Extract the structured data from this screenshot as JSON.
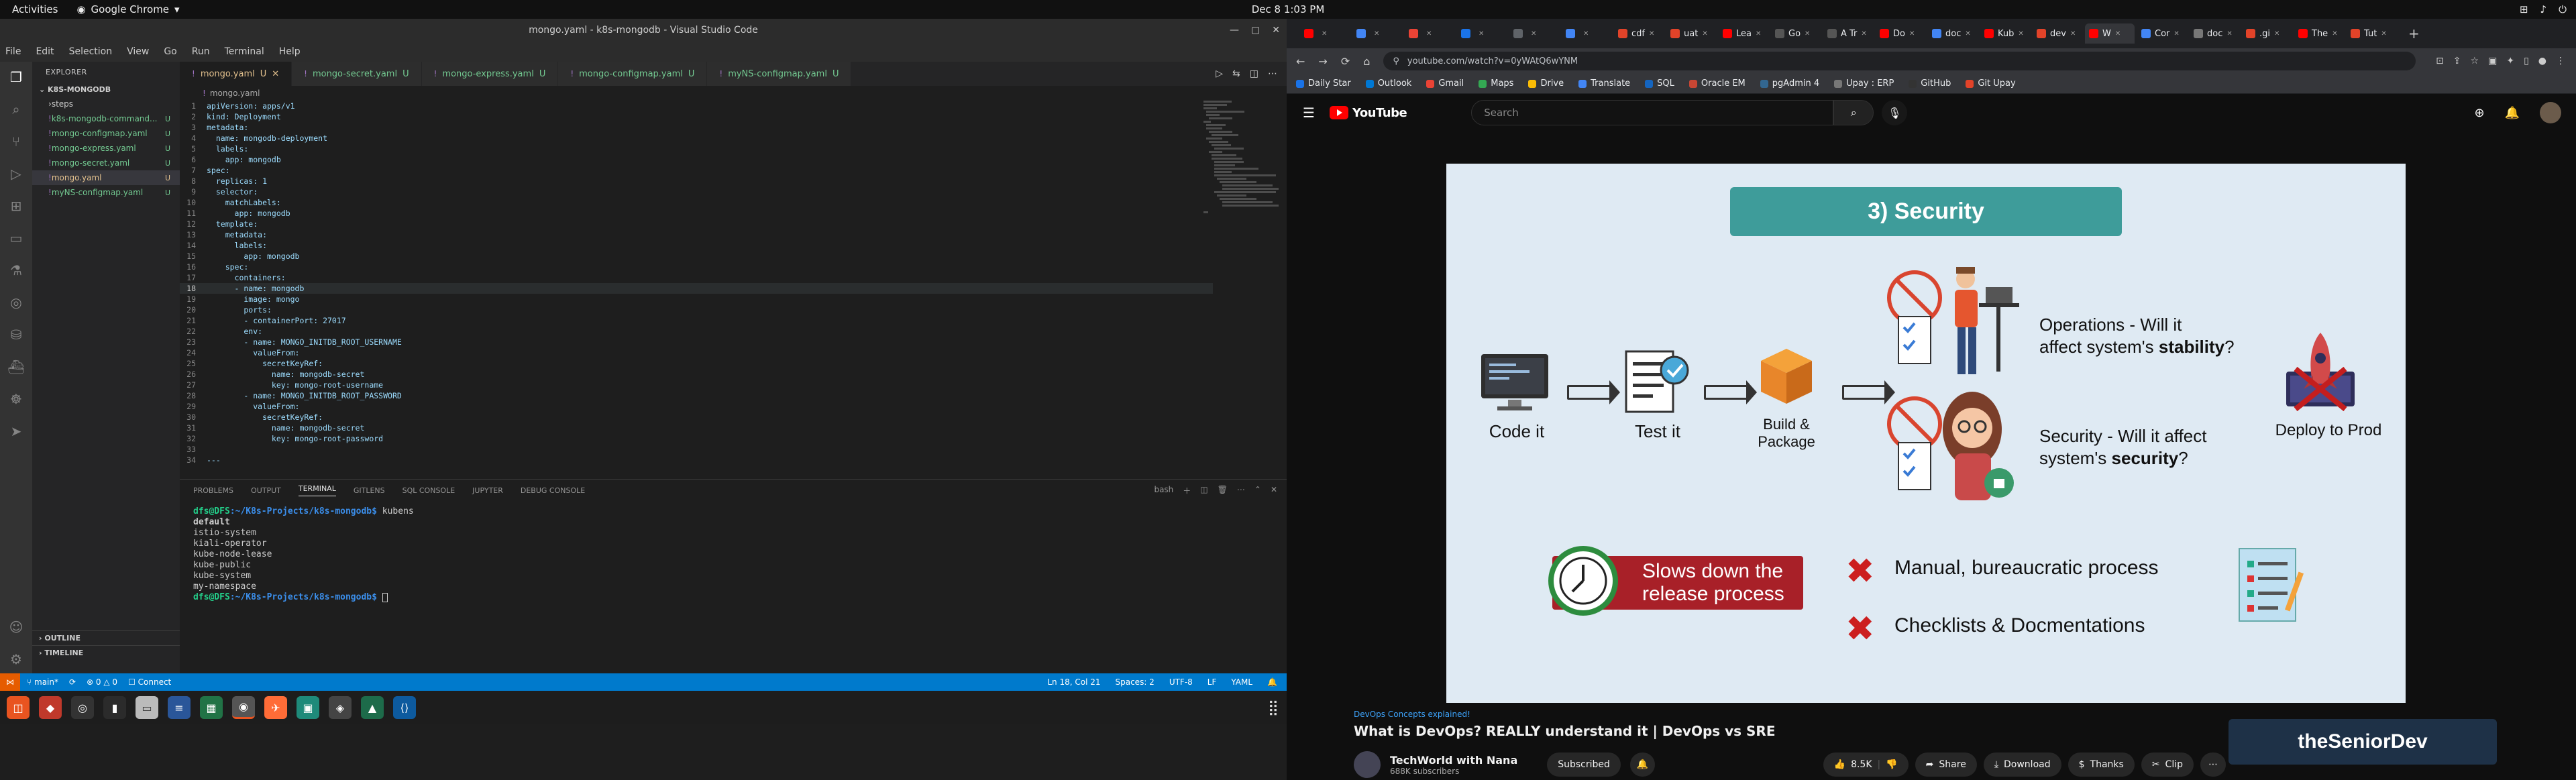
{
  "topbar": {
    "activities": "Activities",
    "app": "Google Chrome",
    "clock": "Dec 8  1:03 PM"
  },
  "vscode": {
    "window_title": "mongo.yaml - k8s-mongodb - Visual Studio Code",
    "menu": [
      "File",
      "Edit",
      "Selection",
      "View",
      "Go",
      "Run",
      "Terminal",
      "Help"
    ],
    "explorer_label": "EXPLORER",
    "folder": "K8S-MONGODB",
    "files": [
      {
        "name": "steps",
        "badge": "",
        "folder": true
      },
      {
        "name": "k8s-mongodb-command...",
        "badge": "U"
      },
      {
        "name": "mongo-configmap.yaml",
        "badge": "U"
      },
      {
        "name": "mongo-express.yaml",
        "badge": "U"
      },
      {
        "name": "mongo-secret.yaml",
        "badge": "U"
      },
      {
        "name": "mongo.yaml",
        "badge": "U",
        "active": true
      },
      {
        "name": "myNS-configmap.yaml",
        "badge": "U"
      }
    ],
    "outline": "OUTLINE",
    "timeline": "TIMELINE",
    "tabs": [
      {
        "name": "mongo.yaml",
        "badge": "U",
        "active": true
      },
      {
        "name": "mongo-secret.yaml",
        "badge": "U"
      },
      {
        "name": "mongo-express.yaml",
        "badge": "U"
      },
      {
        "name": "mongo-configmap.yaml",
        "badge": "U"
      },
      {
        "name": "myNS-configmap.yaml",
        "badge": "U"
      }
    ],
    "breadcrumb": "mongo.yaml",
    "code": [
      "apiVersion: apps/v1",
      "kind: Deployment",
      "metadata:",
      "  name: mongodb-deployment",
      "  labels:",
      "    app: mongodb",
      "spec:",
      "  replicas: 1",
      "  selector:",
      "    matchLabels:",
      "      app: mongodb",
      "  template:",
      "    metadata:",
      "      labels:",
      "        app: mongodb",
      "    spec:",
      "      containers:",
      "      - name: mongodb",
      "        image: mongo",
      "        ports:",
      "        - containerPort: 27017",
      "        env:",
      "        - name: MONGO_INITDB_ROOT_USERNAME",
      "          valueFrom:",
      "            secretKeyRef:",
      "              name: mongodb-secret",
      "              key: mongo-root-username",
      "        - name: MONGO_INITDB_ROOT_PASSWORD",
      "          valueFrom:",
      "            secretKeyRef:",
      "              name: mongodb-secret",
      "              key: mongo-root-password",
      "",
      "---"
    ],
    "current_line": 18,
    "panel_tabs": [
      "PROBLEMS",
      "OUTPUT",
      "TERMINAL",
      "GITLENS",
      "SQL CONSOLE",
      "JUPYTER",
      "DEBUG CONSOLE"
    ],
    "panel_active": "TERMINAL",
    "terminal_shell": "bash",
    "terminal": {
      "prompt_user": "dfs@DFS",
      "prompt_path": ":~/K8s-Projects/k8s-mongodb$",
      "command": "kubens",
      "output": [
        "default",
        "istio-system",
        "kiali-operator",
        "kube-node-lease",
        "kube-public",
        "kube-system",
        "my-namespace"
      ]
    },
    "status": {
      "branch": "main*",
      "problems": "⊗ 0 △ 0",
      "connect": "Connect",
      "position": "Ln 18, Col 21",
      "spaces": "Spaces: 2",
      "encoding": "UTF-8",
      "eol": "LF",
      "language": "YAML"
    }
  },
  "chrome": {
    "tabs": [
      {
        "label": "",
        "color": "#ff0000"
      },
      {
        "label": "",
        "color": "#4285f4"
      },
      {
        "label": "",
        "color": "#ea4335"
      },
      {
        "label": "",
        "color": "#1a73e8"
      },
      {
        "label": "",
        "color": "#5f6368"
      },
      {
        "label": "",
        "color": "#4285f4"
      },
      {
        "label": "cdf",
        "color": "#e24329"
      },
      {
        "label": "uat",
        "color": "#e24329"
      },
      {
        "label": "Lea",
        "color": "#ff0000"
      },
      {
        "label": "Go",
        "color": "#555555"
      },
      {
        "label": "A Tr",
        "color": "#555555"
      },
      {
        "label": "Do",
        "color": "#ff0000"
      },
      {
        "label": "doc",
        "color": "#4285f4"
      },
      {
        "label": "Kub",
        "color": "#ff0000"
      },
      {
        "label": "dev",
        "color": "#e24329"
      },
      {
        "label": "W",
        "color": "#ff0000",
        "active": true
      },
      {
        "label": "Cor",
        "color": "#4285f4"
      },
      {
        "label": "doc",
        "color": "#777777"
      },
      {
        "label": ".gi",
        "color": "#e24329"
      },
      {
        "label": "The",
        "color": "#ff0000"
      },
      {
        "label": "Tut",
        "color": "#e24329"
      }
    ],
    "url": "youtube.com/watch?v=0yWAtQ6wYNM",
    "bookmarks": [
      {
        "label": "Daily Star",
        "color": "#1a73e8"
      },
      {
        "label": "Outlook",
        "color": "#0078d4"
      },
      {
        "label": "Gmail",
        "color": "#ea4335"
      },
      {
        "label": "Maps",
        "color": "#34a853"
      },
      {
        "label": "Drive",
        "color": "#fbbc05"
      },
      {
        "label": "Translate",
        "color": "#4285f4"
      },
      {
        "label": "SQL",
        "color": "#1565c0"
      },
      {
        "label": "Oracle EM",
        "color": "#c74634"
      },
      {
        "label": "pgAdmin 4",
        "color": "#336791"
      },
      {
        "label": "Upay : ERP",
        "color": "#777777"
      },
      {
        "label": "GitHub",
        "color": "#333333"
      },
      {
        "label": "Git Upay",
        "color": "#e24329"
      }
    ]
  },
  "youtube": {
    "logo": "YouTube",
    "search_placeholder": "Search",
    "slide": {
      "title": "3) Security",
      "stages": [
        "Code it",
        "Test it",
        "Build &\nPackage",
        "Deploy to Prod"
      ],
      "ops_prefix": "Operations - Will it\naffect system's ",
      "ops_bold": "stability",
      "ops_suffix": "?",
      "sec_prefix": "Security - Will it affect\nsystem's ",
      "sec_bold": "security",
      "sec_suffix": "?",
      "slow": "Slows down the\nrelease process",
      "x1": "Manual, bureaucratic process",
      "x2": "Checklists & Docmentations"
    },
    "video": {
      "tag": "DevOps Concepts explained!",
      "title": "What is DevOps? REALLY understand it | DevOps vs SRE",
      "channel": "TechWorld with Nana",
      "subs": "688K subscribers",
      "subscribed": "Subscribed",
      "likes": "8.5K",
      "share": "Share",
      "download": "Download",
      "thanks": "Thanks",
      "clip": "Clip"
    },
    "ad_text": "theSeniorDev"
  }
}
